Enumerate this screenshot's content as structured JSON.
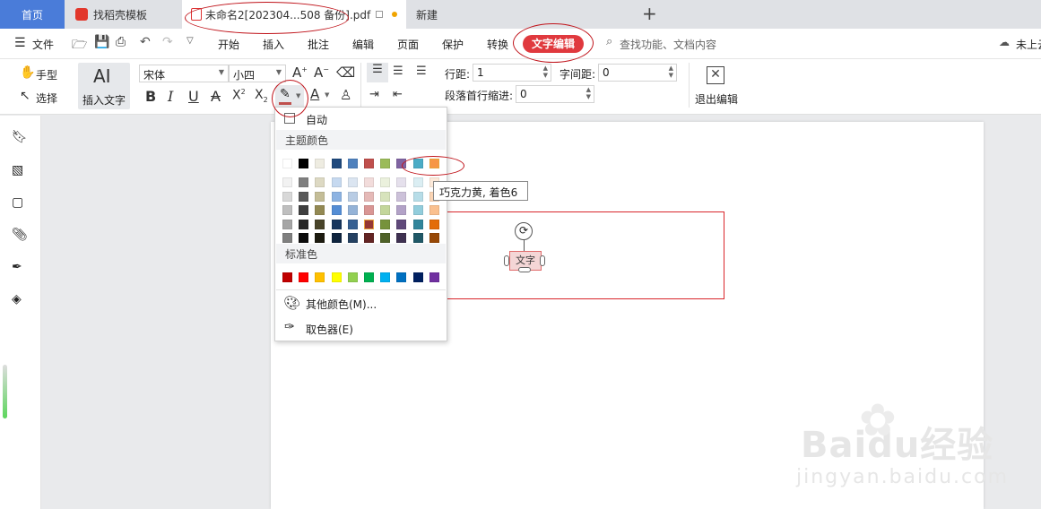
{
  "tabs": {
    "home": "首页",
    "template": "找稻壳模板",
    "document": "未命名2[202304...508 备份].pdf",
    "new": "新建",
    "add": "+"
  },
  "menu": {
    "file": "文件",
    "items": [
      "开始",
      "插入",
      "批注",
      "编辑",
      "页面",
      "保护",
      "转换",
      "文字编辑"
    ],
    "search_placeholder": "查找功能、文档内容",
    "cloud": "未上云"
  },
  "ribbon": {
    "hand": "手型",
    "select": "选择",
    "insert_text": "插入文字",
    "font_name": "宋体",
    "font_size": "小四",
    "line_spacing_label": "行距:",
    "line_spacing_value": "1",
    "char_spacing_label": "字间距:",
    "char_spacing_value": "0",
    "indent_label": "段落首行缩进:",
    "indent_value": "0",
    "exit_edit": "退出编辑"
  },
  "color_dropdown": {
    "auto": "自动",
    "theme_header": "主题颜色",
    "standard_header": "标准色",
    "more_colors": "其他颜色(M)...",
    "eyedropper": "取色器(E)",
    "theme_top": [
      "#ffffff",
      "#000000",
      "#eeece1",
      "#1f497d",
      "#4f81bd",
      "#c0504d",
      "#9bbb59",
      "#8064a2",
      "#4bacc6",
      "#f79646"
    ],
    "theme_shades": [
      [
        "#f2f2f2",
        "#7f7f7f",
        "#ddd9c3",
        "#c6d9f0",
        "#dbe5f1",
        "#f2dcdb",
        "#ebf1dd",
        "#e5e0ec",
        "#dbeef3",
        "#fdeada"
      ],
      [
        "#d8d8d8",
        "#595959",
        "#c4bd97",
        "#8db3e2",
        "#b8cce4",
        "#e5b9b7",
        "#d7e3bc",
        "#ccc1d9",
        "#b7dde8",
        "#fbd5b5"
      ],
      [
        "#bfbfbf",
        "#3f3f3f",
        "#938953",
        "#548dd4",
        "#95b3d7",
        "#d99694",
        "#c3d69b",
        "#b2a2c7",
        "#92cddc",
        "#fac08f"
      ],
      [
        "#a5a5a5",
        "#262626",
        "#494429",
        "#17365d",
        "#366092",
        "#953734",
        "#76923c",
        "#5f497a",
        "#31859b",
        "#e36c09"
      ],
      [
        "#7f7f7f",
        "#0c0c0c",
        "#1d1b10",
        "#0f243e",
        "#244061",
        "#632423",
        "#4f6128",
        "#3f3151",
        "#205867",
        "#974806"
      ]
    ],
    "standard": [
      "#c00000",
      "#ff0000",
      "#ffc000",
      "#ffff00",
      "#92d050",
      "#00b050",
      "#00b0f0",
      "#0070c0",
      "#002060",
      "#7030a0"
    ],
    "tooltip": "巧克力黄, 着色6"
  },
  "page": {
    "textbox_text": "文字"
  },
  "watermark": {
    "brand": "Baidu经验",
    "url": "jingyan.baidu.com"
  },
  "colors": {
    "accent_red": "#e0393e",
    "tab_blue": "#4a7cd9",
    "annotation_red": "#c0141b"
  }
}
